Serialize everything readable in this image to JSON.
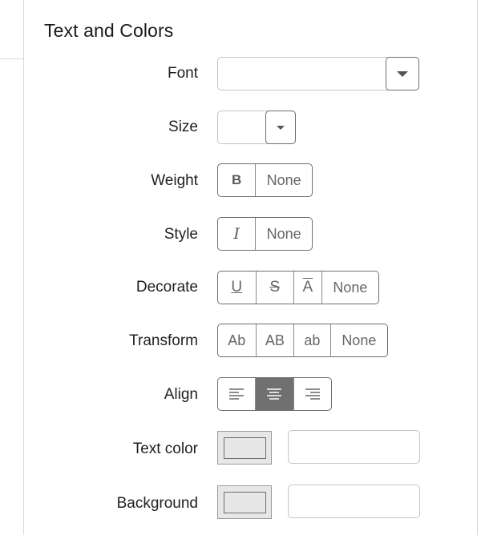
{
  "section": {
    "title": "Text and Colors"
  },
  "font": {
    "label": "Font",
    "value": ""
  },
  "size": {
    "label": "Size",
    "value": ""
  },
  "weight": {
    "label": "Weight",
    "options": [
      "B",
      "None"
    ]
  },
  "style": {
    "label": "Style",
    "options": [
      "I",
      "None"
    ]
  },
  "decorate": {
    "label": "Decorate",
    "options": [
      "U",
      "S",
      "A",
      "None"
    ]
  },
  "transform": {
    "label": "Transform",
    "options": [
      "Ab",
      "AB",
      "ab",
      "None"
    ]
  },
  "align": {
    "label": "Align",
    "options": [
      "align-left-icon",
      "align-center-icon",
      "align-right-icon"
    ],
    "selected": "align-center-icon"
  },
  "text_color": {
    "label": "Text color",
    "swatch": "#e7e7e7",
    "value": ""
  },
  "background": {
    "label": "Background",
    "swatch": "#e7e7e7",
    "value": ""
  }
}
